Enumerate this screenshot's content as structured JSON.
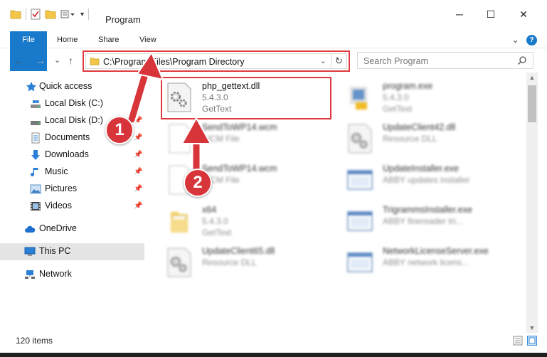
{
  "window": {
    "title": "Program",
    "minimize": "─",
    "maximize": "☐",
    "close": "✕"
  },
  "ribbon": {
    "tabs": [
      "File",
      "Home",
      "Share",
      "View"
    ],
    "expand": "⌄",
    "help": "?"
  },
  "address": {
    "path": "C:\\Program Files\\Program Directory",
    "dropdown": "⌄",
    "refresh": "↻"
  },
  "search": {
    "placeholder": "Search Program"
  },
  "nav": {
    "back": "←",
    "forward": "→",
    "recent": "⌄",
    "up": "↑",
    "items": [
      {
        "label": "Quick access",
        "icon": "star-icon",
        "pinned": false
      },
      {
        "label": "Local Disk (C:)",
        "icon": "drive-icon",
        "pinned": true
      },
      {
        "label": "Local Disk (D:)",
        "icon": "drive-icon",
        "pinned": true
      },
      {
        "label": "Documents",
        "icon": "documents-icon",
        "pinned": true
      },
      {
        "label": "Downloads",
        "icon": "download-icon",
        "pinned": true
      },
      {
        "label": "Music",
        "icon": "music-icon",
        "pinned": true
      },
      {
        "label": "Pictures",
        "icon": "pictures-icon",
        "pinned": true
      },
      {
        "label": "Videos",
        "icon": "videos-icon",
        "pinned": true
      },
      {
        "label": "OneDrive",
        "icon": "cloud-icon",
        "pinned": false
      },
      {
        "label": "This PC",
        "icon": "pc-icon",
        "pinned": false
      },
      {
        "label": "Network",
        "icon": "network-icon",
        "pinned": false
      }
    ]
  },
  "files": [
    {
      "name": "php_gettext.dll",
      "line1": "5.4.3.0",
      "line2": "GetText",
      "icon": "dll-gear-icon"
    },
    {
      "name": "program.exe",
      "line1": "5.4.3.0",
      "line2": "GetText",
      "icon": "exe-icon"
    },
    {
      "name": "SendToWP14.wcm",
      "line1": "WCM File",
      "line2": "",
      "icon": "blank-file-icon"
    },
    {
      "name": "UpdateClient42.dll",
      "line1": "Resource DLL",
      "line2": "",
      "icon": "dll-gear-icon"
    },
    {
      "name": "SendToWP14.wcm",
      "line1": "WCM File",
      "line2": "",
      "icon": "blank-file-icon"
    },
    {
      "name": "UpdateInstaller.exe",
      "line1": "ABBY updates installer",
      "line2": "",
      "icon": "exe-window-icon"
    },
    {
      "name": "x64",
      "line1": "5.4.3.0",
      "line2": "GetText",
      "icon": "folder-icon"
    },
    {
      "name": "TrigrammsInstaller.exe",
      "line1": "ABBY finereader tri...",
      "line2": "",
      "icon": "exe-window-icon"
    },
    {
      "name": "UpdateClient65.dll",
      "line1": "Resource DLL",
      "line2": "",
      "icon": "dll-gear-icon"
    },
    {
      "name": "NetworkLicenseServer.exe",
      "line1": "ABBY network licens...",
      "line2": "",
      "icon": "exe-window-icon"
    }
  ],
  "status": {
    "count": "120 items"
  },
  "annotations": {
    "step1": "1",
    "step2": "2",
    "color": "#d8353b"
  },
  "colors": {
    "accent": "#1979ca",
    "highlight": "#e03a3e"
  }
}
